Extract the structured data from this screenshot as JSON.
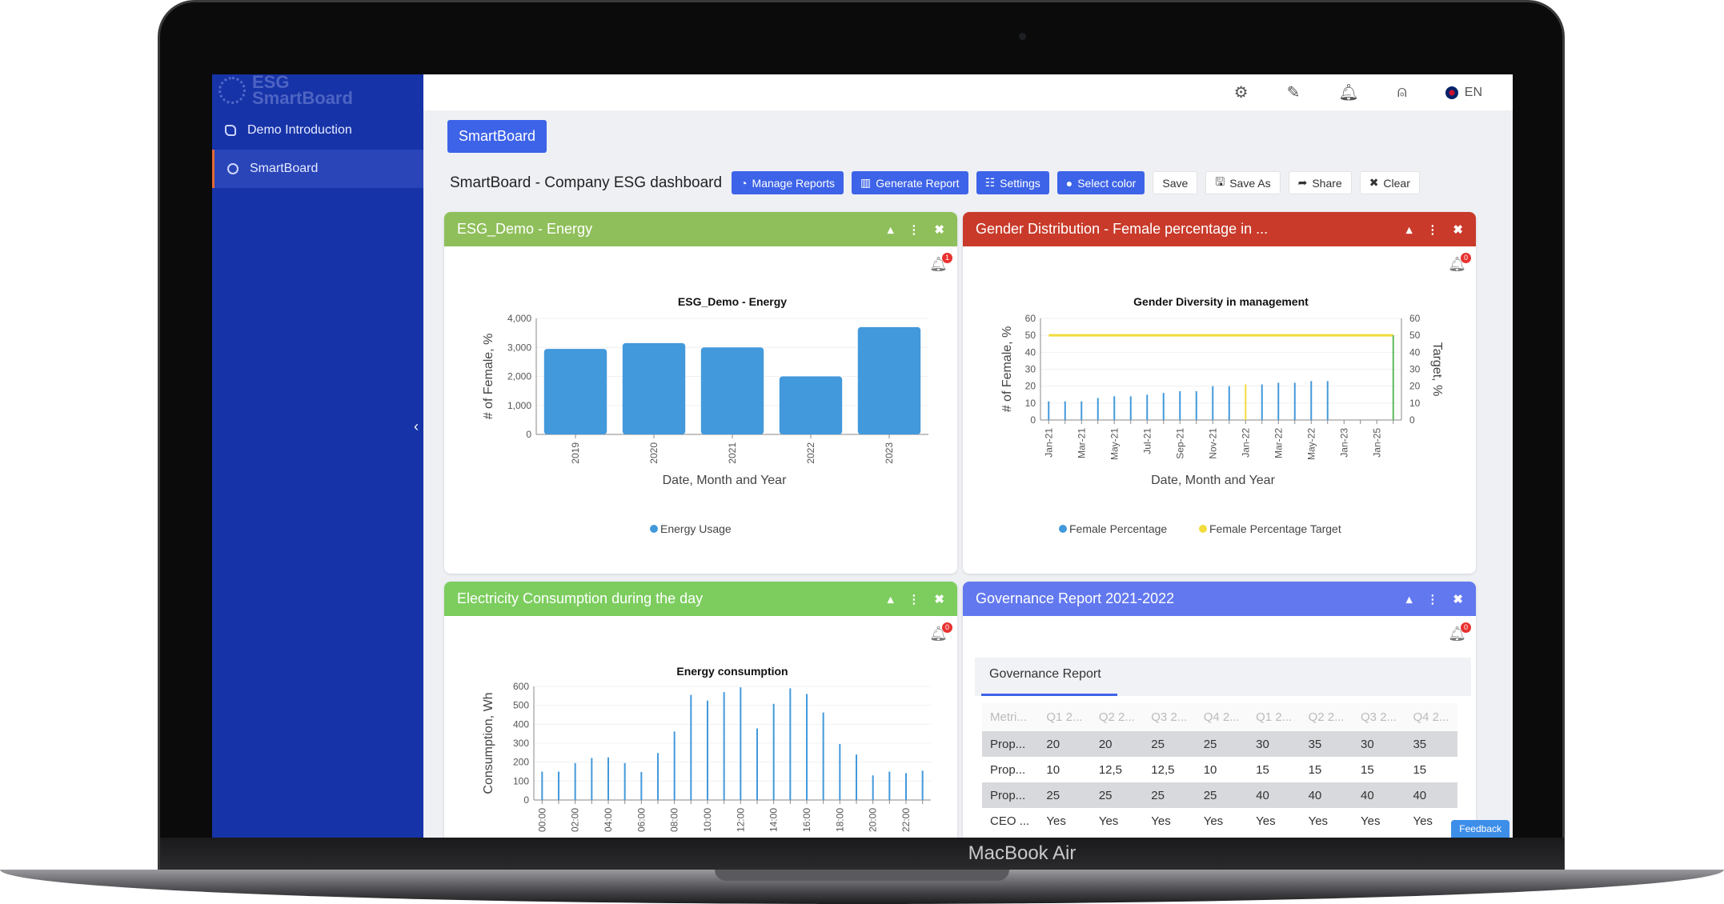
{
  "device_label": "MacBook Air",
  "sidebar": {
    "logo": [
      "ESG",
      "SmartBoard"
    ],
    "items": [
      {
        "label": "Demo Introduction",
        "active": false
      },
      {
        "label": "SmartBoard",
        "active": true
      }
    ]
  },
  "topbar": {
    "icons": [
      "gear-icon",
      "edit-icon",
      "bell-icon",
      "user-icon"
    ],
    "language": "EN"
  },
  "smartboard_button": "SmartBoard",
  "toolbar": {
    "title": "SmartBoard - Company ESG dashboard",
    "buttons": [
      {
        "label": "Manage Reports",
        "icon": "◔",
        "style": "blue"
      },
      {
        "label": "Generate Report",
        "icon": "▥",
        "style": "blue"
      },
      {
        "label": "Settings",
        "icon": "☷",
        "style": "blue"
      },
      {
        "label": "Select color",
        "icon": "●",
        "style": "blue"
      },
      {
        "label": "Save",
        "icon": "",
        "style": "white"
      },
      {
        "label": "Save As",
        "icon": "🖫",
        "style": "white"
      },
      {
        "label": "Share",
        "icon": "➦",
        "style": "white"
      },
      {
        "label": "Clear",
        "icon": "✖",
        "style": "white"
      }
    ]
  },
  "panels": [
    {
      "title": "ESG_Demo - Energy",
      "color": "#8fbf5a",
      "alerts": "1"
    },
    {
      "title": "Gender Distribution - Female percentage in ...",
      "color": "#c93a2a",
      "alerts": "0"
    },
    {
      "title": "Electricity Consumption during the day",
      "color": "#7ccd5e",
      "alerts": "0"
    },
    {
      "title": "Governance Report 2021-2022",
      "color": "#6278ef",
      "alerts": "0"
    }
  ],
  "chart_data": [
    {
      "type": "bar",
      "title": "ESG_Demo - Energy",
      "xlabel": "Date, Month and Year",
      "ylabel": "# of Female, %",
      "categories": [
        "2019",
        "2020",
        "2021",
        "2022",
        "2023"
      ],
      "series": [
        {
          "name": "Energy Usage",
          "values": [
            2950,
            3150,
            3000,
            2000,
            3700
          ],
          "color": "#4299db"
        }
      ],
      "ylim": [
        0,
        4000
      ],
      "yticks": [
        "0",
        "1,000",
        "2,000",
        "3,000",
        "4,000"
      ],
      "legend": "bottom",
      "grid": true
    },
    {
      "type": "bar",
      "title": "Gender Diversity in management",
      "xlabel": "Date, Month and Year",
      "ylabel": "# of Female, %",
      "ylabel_right": "Target, %",
      "categories": [
        "Jan-21",
        "",
        "Mar-21",
        "",
        "May-21",
        "",
        "Jul-21",
        "",
        "Sep-21",
        "",
        "Nov-21",
        "",
        "Jan-22",
        "",
        "Mar-22",
        "",
        "May-22",
        "",
        "Jan-23",
        "",
        "Jan-25",
        ""
      ],
      "series": [
        {
          "name": "Female Percentage",
          "values": [
            11,
            11,
            11,
            13,
            14,
            14,
            15,
            16,
            17,
            17,
            20,
            20,
            21,
            21,
            22,
            22,
            23,
            23,
            null,
            null,
            null,
            null
          ],
          "color": "#4299db"
        },
        {
          "name": "Female Percentage Target",
          "values": [
            50,
            50,
            50,
            50,
            50,
            50,
            50,
            50,
            50,
            50,
            50,
            50,
            50,
            50,
            50,
            50,
            50,
            50,
            50,
            50,
            50,
            50
          ],
          "color": "#f2dc3c"
        }
      ],
      "ylim": [
        0,
        60
      ],
      "yticks": [
        "0",
        "10",
        "20",
        "30",
        "40",
        "50",
        "60"
      ],
      "legend": "bottom",
      "grid": true
    },
    {
      "type": "bar",
      "title": "Energy consumption",
      "ylabel": "Consumption, Wh",
      "categories": [
        "00:00",
        "",
        "02:00",
        "",
        "04:00",
        "",
        "06:00",
        "",
        "08:00",
        "",
        "10:00",
        "",
        "12:00",
        "",
        "14:00",
        "",
        "16:00",
        "",
        "18:00",
        "",
        "20:00",
        "",
        "22:00",
        ""
      ],
      "series": [
        {
          "values": [
            150,
            150,
            195,
            222,
            225,
            195,
            148,
            248,
            362,
            555,
            525,
            570,
            595,
            378,
            508,
            590,
            560,
            462,
            296,
            240,
            130,
            150,
            142,
            155
          ],
          "color": "#4299db"
        }
      ],
      "ylim": [
        0,
        600
      ],
      "yticks": [
        "0",
        "100",
        "200",
        "300",
        "400",
        "500",
        "600"
      ],
      "grid": true
    }
  ],
  "governance": {
    "tab": "Governance Report",
    "headers": [
      "Metri...",
      "Q1 2...",
      "Q2 2...",
      "Q3 2...",
      "Q4 2...",
      "Q1 2...",
      "Q2 2...",
      "Q3 2...",
      "Q4 2..."
    ],
    "rows": [
      [
        "Prop...",
        "20",
        "20",
        "25",
        "25",
        "30",
        "35",
        "30",
        "35"
      ],
      [
        "Prop...",
        "10",
        "12,5",
        "12,5",
        "10",
        "15",
        "15",
        "15",
        "15"
      ],
      [
        "Prop...",
        "25",
        "25",
        "25",
        "25",
        "40",
        "40",
        "40",
        "40"
      ],
      [
        "CEO ...",
        "Yes",
        "Yes",
        "Yes",
        "Yes",
        "Yes",
        "Yes",
        "Yes",
        "Yes"
      ]
    ]
  },
  "feedback": "Feedback"
}
